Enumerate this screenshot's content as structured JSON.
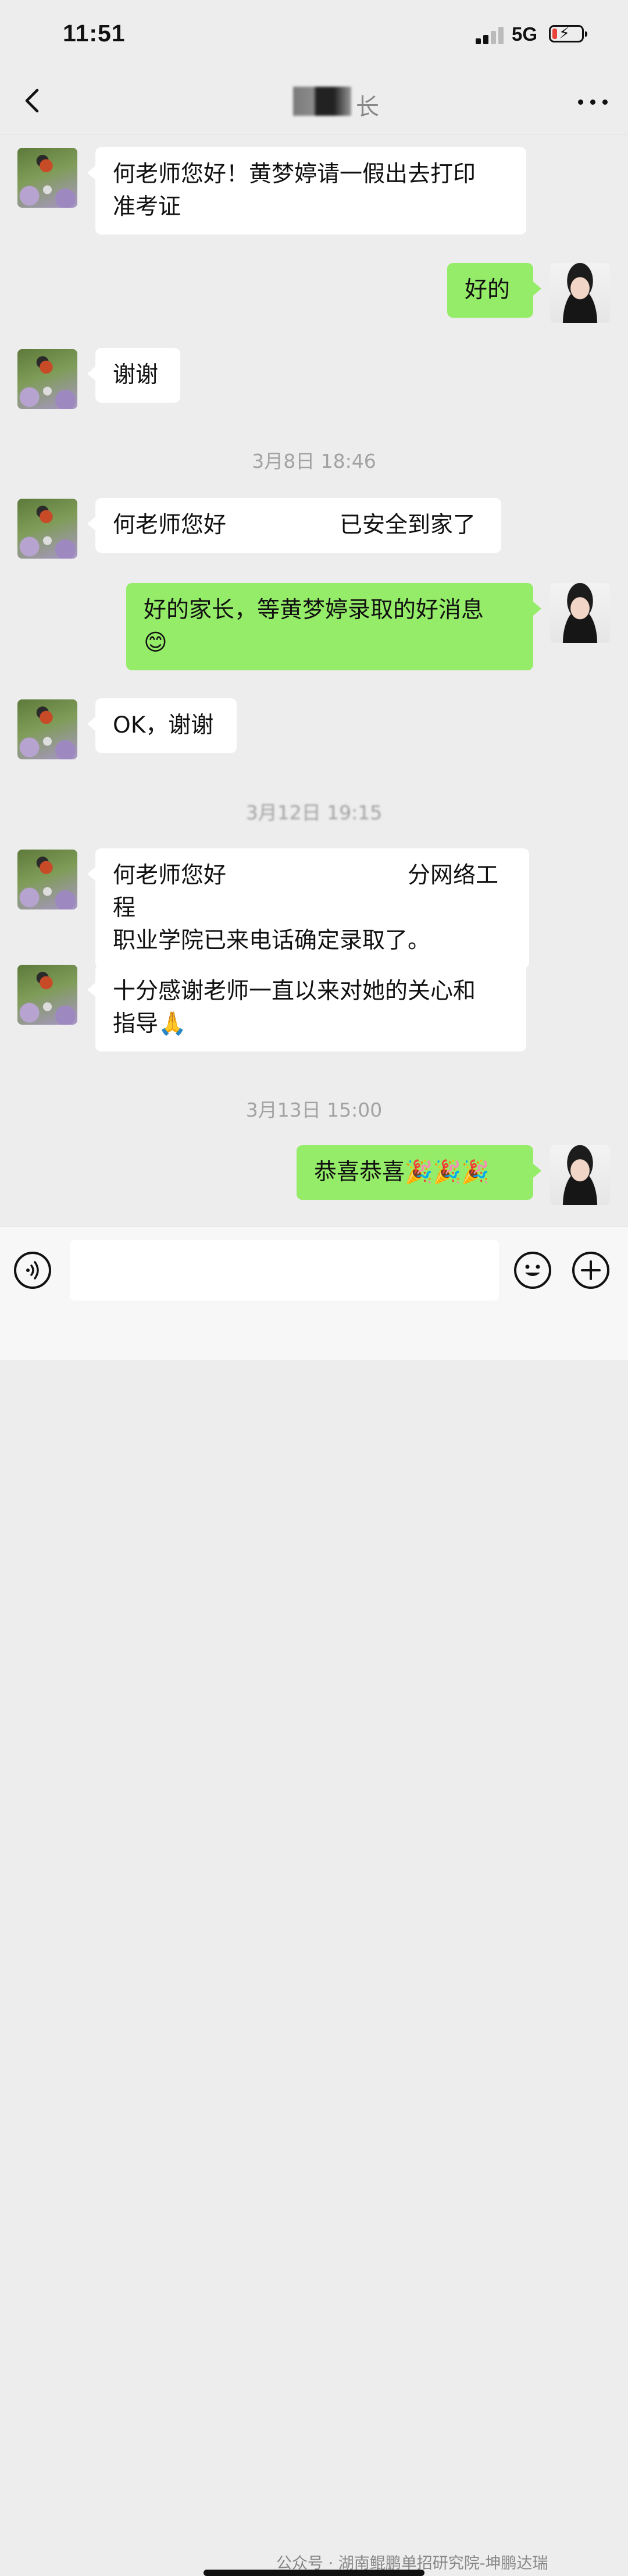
{
  "status": {
    "time": "11:51",
    "network": "5G"
  },
  "nav": {
    "title": "长"
  },
  "messages": [
    {
      "side": "in",
      "text": "何老师您好！黄梦婷请一假出去打印\n准考证"
    },
    {
      "side": "out",
      "text": "好的"
    },
    {
      "side": "in",
      "text": "谢谢"
    },
    {
      "type": "time",
      "text": "3月8日 18:46"
    },
    {
      "side": "in",
      "text": "何老师您好　　　　　已安全到家了"
    },
    {
      "side": "out",
      "text": "好的家长，等黄梦婷录取的好消息\n😊"
    },
    {
      "side": "in",
      "text": "OK，谢谢"
    },
    {
      "type": "time",
      "text": "3月12日 19:15"
    },
    {
      "side": "in",
      "text": "何老师您好　　　　　　　　分网络工程\n职业学院已来电话确定录取了。"
    },
    {
      "side": "in",
      "text": "十分感谢老师一直以来对她的关心和\n指导🙏"
    },
    {
      "type": "time",
      "text": "3月13日 15:00"
    },
    {
      "side": "out",
      "text": "恭喜恭喜🎉🎉🎉"
    }
  ],
  "input": {
    "placeholder": ""
  },
  "watermark": "公众号 · 湖南鲲鹏单招研究院-坤鹏达瑞",
  "icons": {
    "back": "chevron-left-icon",
    "more": "more-dots-icon",
    "voice": "voice-icon",
    "emoji": "emoji-icon",
    "plus": "plus-icon"
  },
  "colors": {
    "background": "#ededed",
    "out_bubble": "#95ec69",
    "in_bubble": "#ffffff"
  }
}
